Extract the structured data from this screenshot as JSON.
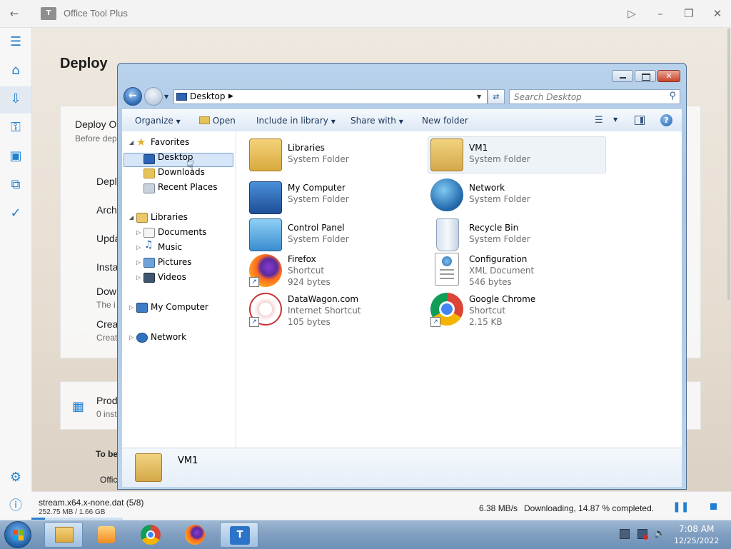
{
  "app": {
    "title": "Office Tool Plus",
    "logo_text": "T",
    "page_title": "Deploy",
    "card1": {
      "title": "Deploy O",
      "subtitle": "Before dep"
    },
    "settings": [
      {
        "label": "Depl",
        "sub": ""
      },
      {
        "label": "Arch",
        "sub": ""
      },
      {
        "label": "Upda",
        "sub": ""
      },
      {
        "label": "Insta",
        "sub": ""
      },
      {
        "label": "Dow",
        "sub": "The i"
      },
      {
        "label": "Creat",
        "sub": "Creat"
      }
    ],
    "products": {
      "title": "Prod",
      "subtitle": "0 inst",
      "to_be": "To be",
      "office": "Offic"
    }
  },
  "nav_icons": [
    "menu-icon",
    "home-icon",
    "deploy-icon",
    "key-icon",
    "toolbox-icon",
    "convert-icon",
    "document-check-icon",
    "settings-icon",
    "info-icon"
  ],
  "download": {
    "file": "stream.x64.x-none.dat (5/8)",
    "size": "252.75 MB / 1.66 GB",
    "speed": "6.38 MB/s",
    "status": "Downloading, 14.87 % completed.",
    "progress_percent": 14.87
  },
  "explorer": {
    "address": "Desktop",
    "search_placeholder": "Search Desktop",
    "toolbar": {
      "organize": "Organize",
      "open": "Open",
      "include": "Include in library",
      "share": "Share with",
      "new_folder": "New folder"
    },
    "nav": {
      "favorites": "Favorites",
      "desktop": "Desktop",
      "downloads": "Downloads",
      "recent": "Recent Places",
      "libraries": "Libraries",
      "documents": "Documents",
      "music": "Music",
      "pictures": "Pictures",
      "videos": "Videos",
      "computer": "My Computer",
      "network": "Network"
    },
    "items": [
      {
        "name": "Libraries",
        "type": "System Folder",
        "size": ""
      },
      {
        "name": "VM1",
        "type": "System Folder",
        "size": ""
      },
      {
        "name": "My Computer",
        "type": "System Folder",
        "size": ""
      },
      {
        "name": "Network",
        "type": "System Folder",
        "size": ""
      },
      {
        "name": "Control Panel",
        "type": "System Folder",
        "size": ""
      },
      {
        "name": "Recycle Bin",
        "type": "System Folder",
        "size": ""
      },
      {
        "name": "Firefox",
        "type": "Shortcut",
        "size": "924 bytes"
      },
      {
        "name": "Configuration",
        "type": "XML Document",
        "size": "546 bytes"
      },
      {
        "name": "DataWagon.com",
        "type": "Internet Shortcut",
        "size": "105 bytes"
      },
      {
        "name": "Google Chrome",
        "type": "Shortcut",
        "size": "2.15 KB"
      }
    ],
    "details_name": "VM1"
  },
  "taskbar": {
    "time": "7:08 AM",
    "date": "12/25/2022"
  },
  "colors": {
    "accent": "#1f7fd0",
    "selection": "#d6e6f8"
  }
}
